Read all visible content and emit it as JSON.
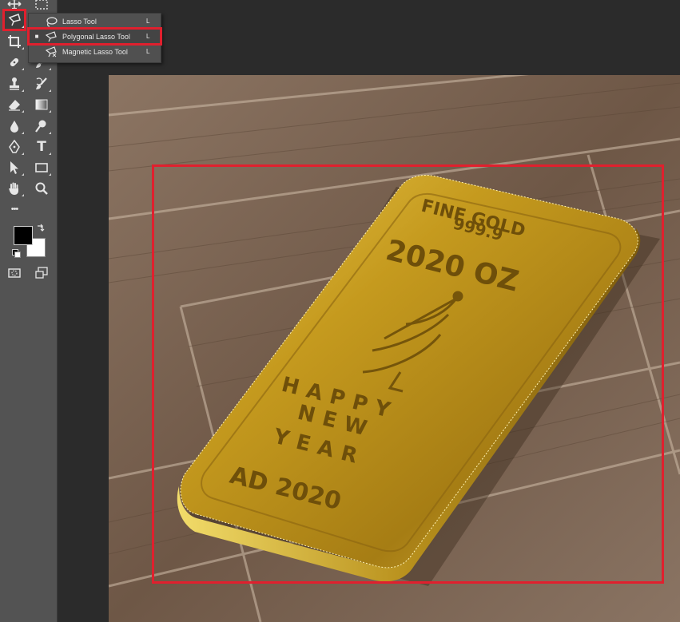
{
  "toolbar": {
    "tools": [
      "move-icon",
      "marquee-icon",
      "polygonal-lasso-icon",
      "crop-icon",
      "healing-brush-icon",
      "brush-icon",
      "clone-stamp-icon",
      "history-brush-icon",
      "eraser-icon",
      "gradient-icon",
      "blur-icon",
      "dodge-icon",
      "pen-icon",
      "type-icon",
      "path-selection-icon",
      "rectangle-icon",
      "hand-icon",
      "zoom-icon",
      "more-tools-icon"
    ],
    "type_glyph": "T",
    "more_glyph": "•••",
    "foreground_color": "#000000",
    "background_color": "#ffffff"
  },
  "flyout": {
    "items": [
      {
        "label": "Lasso Tool",
        "shortcut": "L",
        "icon": "lasso-icon",
        "selected": false
      },
      {
        "label": "Polygonal Lasso Tool",
        "shortcut": "L",
        "icon": "polygonal-lasso-icon",
        "selected": true
      },
      {
        "label": "Magnetic Lasso Tool",
        "shortcut": "L",
        "icon": "magnetic-lasso-icon",
        "selected": false
      }
    ],
    "selected_bullet": "■"
  },
  "canvas": {
    "engraving": {
      "line1": "FINE GOLD",
      "line2": "999.9",
      "line3": "2020 OZ",
      "line4": "HAPPY",
      "line5": "NEW",
      "line6": "YEAR",
      "line7": "AD 2020"
    }
  },
  "colors": {
    "annotation": "#e0202e",
    "toolbar_bg": "#535353",
    "workspace_bg": "#2b2b2b",
    "gold": "#c9a227",
    "wood": "#7a6350"
  }
}
